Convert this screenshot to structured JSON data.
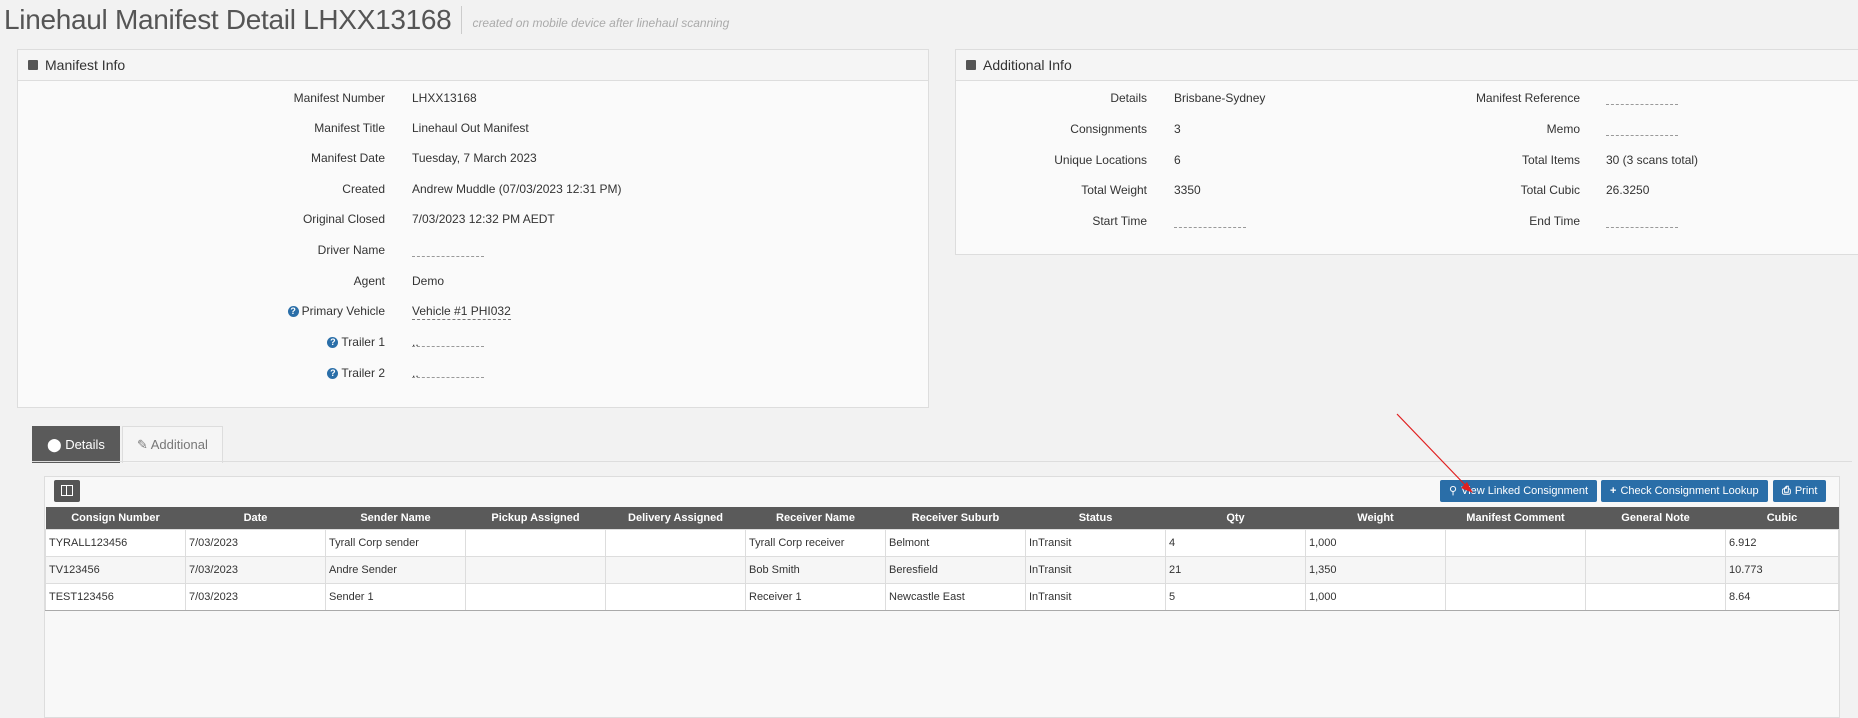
{
  "header": {
    "title": "Linehaul Manifest Detail LHXX13168",
    "subtitle": "created on mobile device after linehaul scanning"
  },
  "manifest_info": {
    "heading": "Manifest Info",
    "fields": [
      {
        "label": "Manifest Number",
        "value": "LHXX13168"
      },
      {
        "label": "Manifest Title",
        "value": "Linehaul Out Manifest"
      },
      {
        "label": "Manifest Date",
        "value": "Tuesday, 7 March 2023"
      },
      {
        "label": "Created",
        "value": "Andrew Muddle (07/03/2023 12:31 PM)"
      },
      {
        "label": "Original Closed",
        "value": "7/03/2023 12:32 PM AEDT"
      },
      {
        "label": "Driver Name",
        "value": ""
      },
      {
        "label": "Agent",
        "value": "Demo"
      },
      {
        "label": "Primary Vehicle",
        "value": "Vehicle #1 PHI032"
      },
      {
        "label": "Trailer 1",
        "value": ".."
      },
      {
        "label": "Trailer 2",
        "value": ".."
      }
    ]
  },
  "additional_info": {
    "heading": "Additional Info",
    "left": [
      {
        "label": "Details",
        "value": "Brisbane-Sydney"
      },
      {
        "label": "Consignments",
        "value": "3"
      },
      {
        "label": "Unique Locations",
        "value": "6"
      },
      {
        "label": "Total Weight",
        "value": "3350"
      },
      {
        "label": "Start Time",
        "value": ""
      }
    ],
    "right": [
      {
        "label": "Manifest Reference",
        "value": ""
      },
      {
        "label": "Memo",
        "value": ""
      },
      {
        "label": "Total Items",
        "value": "30 (3 scans total)"
      },
      {
        "label": "Total Cubic",
        "value": "26.3250"
      },
      {
        "label": "End Time",
        "value": ""
      }
    ]
  },
  "tabs": {
    "details": "Details",
    "additional": "Additional"
  },
  "toolbar": {
    "view_linked": "View Linked Consignment",
    "check_lookup": "Check Consignment Lookup",
    "print": "Print"
  },
  "table": {
    "columns": [
      "Consign Number",
      "Date",
      "Sender Name",
      "Pickup Assigned",
      "Delivery Assigned",
      "Receiver Name",
      "Receiver Suburb",
      "Status",
      "Qty",
      "Weight",
      "Manifest Comment",
      "General Note",
      "Cubic"
    ],
    "rows": [
      [
        "TYRALL123456",
        "7/03/2023",
        "Tyrall Corp sender",
        "",
        "",
        "Tyrall Corp receiver",
        "Belmont",
        "InTransit",
        "4",
        "1,000",
        "",
        "",
        "6.912"
      ],
      [
        "TV123456",
        "7/03/2023",
        "Andre Sender",
        "",
        "",
        "Bob Smith",
        "Beresfield",
        "InTransit",
        "21",
        "1,350",
        "",
        "",
        "10.773"
      ],
      [
        "TEST123456",
        "7/03/2023",
        "Sender 1",
        "",
        "",
        "Receiver 1",
        "Newcastle East",
        "InTransit",
        "5",
        "1,000",
        "",
        "",
        "8.64"
      ]
    ]
  },
  "colors": {
    "primary_button": "#2a6ea8",
    "header_dark": "#5a5a5a",
    "annotation_arrow": "#e02020"
  }
}
